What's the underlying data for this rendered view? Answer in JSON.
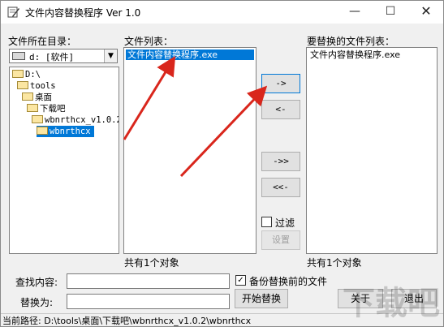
{
  "window": {
    "title": "文件内容替换程序 Ver 1.0",
    "controls": {
      "minimize": "—",
      "maximize": "☐",
      "close": "✕"
    }
  },
  "dir_panel": {
    "label": "文件所在目录：",
    "drive_value": "d: [软件]",
    "tree": [
      "D:\\",
      "tools",
      "桌面",
      "下载吧",
      "wbnrthcx_v1.0.2",
      "wbnrthcx"
    ],
    "selected_index": 5
  },
  "file_panel": {
    "label": "文件列表：",
    "items": [
      "文件内容替换程序.exe"
    ],
    "count_text": "共有1个对象"
  },
  "transfer_buttons": {
    "add": "->",
    "remove": "<-",
    "add_all": "->>",
    "remove_all": "<<-"
  },
  "filter": {
    "label": "过滤",
    "checked": false,
    "settings_button": "设置"
  },
  "target_panel": {
    "label": "要替换的文件列表：",
    "items": [
      "文件内容替换程序.exe"
    ],
    "count_text": "共有1个对象"
  },
  "replace_form": {
    "find_label": "查找内容:",
    "find_value": "",
    "replace_label": "替换为:",
    "replace_value": "",
    "backup_label": "备份替换前的文件",
    "backup_checked": true,
    "start_button": "开始替换",
    "about_button": "关于",
    "exit_button": "退出"
  },
  "status": {
    "current_path": "当前路径: D:\\tools\\桌面\\下载吧\\wbnrthcx_v1.0.2\\wbnrthcx"
  },
  "colors": {
    "selection": "#0078d7",
    "annotation_arrow": "#d9261c",
    "window_bg": "#f0f0f0"
  },
  "watermark": {
    "text": "下载吧"
  }
}
